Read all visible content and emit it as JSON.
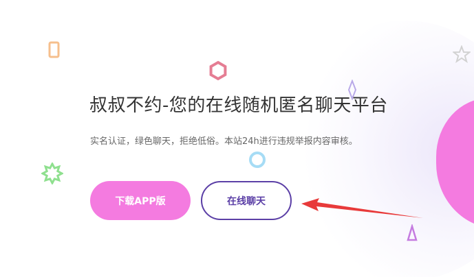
{
  "hero": {
    "title": "叔叔不约-您的在线随机匿名聊天平台",
    "subtitle": "实名认证，绿色聊天，拒绝低俗。本站24h进行违规举报内容审核。"
  },
  "buttons": {
    "download_label": "下载APP版",
    "chat_label": "在线聊天"
  },
  "colors": {
    "primary_pink": "#f47be0",
    "primary_purple": "#5b3fa6",
    "annotation_arrow": "#e83a3a"
  },
  "decorations": {
    "icons": [
      "phone-icon",
      "hexagon-icon",
      "diamond-icon",
      "star-icon",
      "ring-icon",
      "starburst-icon",
      "triangle-icon"
    ]
  }
}
